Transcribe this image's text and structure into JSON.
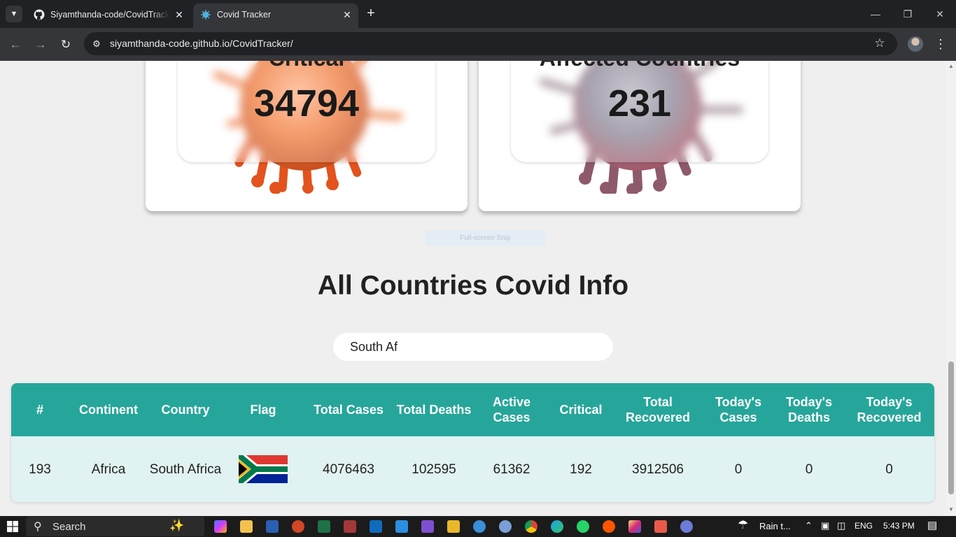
{
  "browser": {
    "tabs": [
      {
        "title": "Siyamthanda-code/CovidTracker",
        "active": false,
        "icon": "github-icon"
      },
      {
        "title": "Covid Tracker",
        "active": true,
        "icon": "virus-favicon-icon"
      }
    ],
    "url": "siyamthanda-code.github.io/CovidTracker/"
  },
  "stats": [
    {
      "label": "Critical",
      "value": "34794",
      "color": "#f07a3a"
    },
    {
      "label": "Affected Countries",
      "value": "231",
      "color": "#9a8a96"
    }
  ],
  "snip_overlay": "Full-screen Snip",
  "section": {
    "title": "All Countries Covid Info",
    "search_value": "South Af"
  },
  "table": {
    "headers": [
      "#",
      "Continent",
      "Country",
      "Flag",
      "Total Cases",
      "Total Deaths",
      "Active Cases",
      "Critical",
      "Total Recovered",
      "Today's Cases",
      "Today's Deaths",
      "Today's Recovered"
    ],
    "rows": [
      {
        "rank": "193",
        "continent": "Africa",
        "country": "South Africa",
        "flag": "south-africa-flag-icon",
        "total_cases": "4076463",
        "total_deaths": "102595",
        "active_cases": "61362",
        "critical": "192",
        "total_recovered": "3912506",
        "today_cases": "0",
        "today_deaths": "0",
        "today_recovered": "0"
      }
    ]
  },
  "taskbar": {
    "search_placeholder": "Search",
    "weather": "Rain t...",
    "language": "ENG",
    "time": "5:43 PM"
  },
  "colors": {
    "header_teal": "#26a69a",
    "row_bg": "#e0f2f1",
    "page_bg": "#efefef"
  }
}
